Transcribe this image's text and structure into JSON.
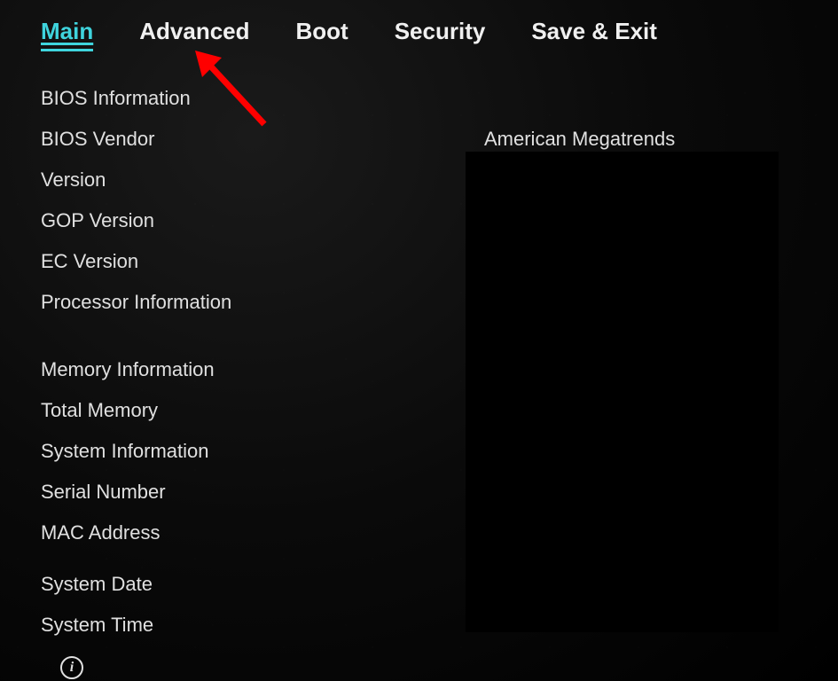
{
  "tabs": {
    "main": "Main",
    "advanced": "Advanced",
    "boot": "Boot",
    "security": "Security",
    "save_exit": "Save & Exit"
  },
  "sections": {
    "bios_info_header": "BIOS Information",
    "bios_vendor_label": "BIOS Vendor",
    "bios_vendor_value": "American Megatrends",
    "version_label": "Version",
    "gop_version_label": "GOP Version",
    "ec_version_label": "EC Version",
    "processor_info_header": "Processor Information",
    "memory_info_header": "Memory Information",
    "total_memory_label": "Total Memory",
    "system_info_header": "System Information",
    "serial_number_label": "Serial Number",
    "mac_address_label": "MAC Address",
    "system_date_label": "System Date",
    "system_time_label": "System Time"
  },
  "annotation": {
    "arrow_color": "#ff0000",
    "arrow_target": "advanced-tab"
  }
}
